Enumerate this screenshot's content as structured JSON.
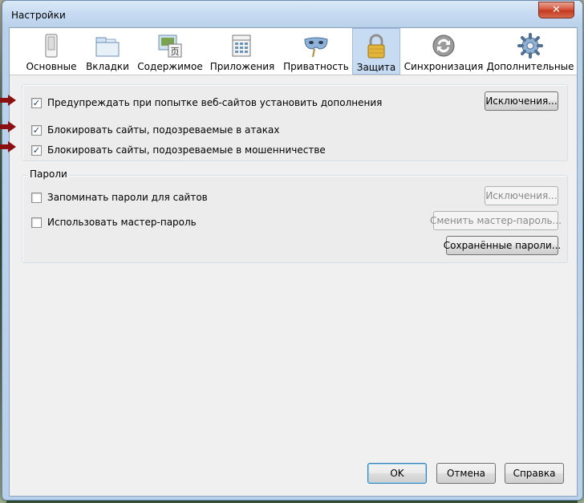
{
  "window": {
    "title": "Настройки",
    "close_glyph": "✕"
  },
  "toolbar": {
    "items": [
      {
        "label": "Основные",
        "icon": "switch-icon"
      },
      {
        "label": "Вкладки",
        "icon": "tabs-icon"
      },
      {
        "label": "Содержимое",
        "icon": "content-icon"
      },
      {
        "label": "Приложения",
        "icon": "applications-icon"
      },
      {
        "label": "Приватность",
        "icon": "mask-icon"
      },
      {
        "label": "Защита",
        "icon": "padlock-icon",
        "selected": true
      },
      {
        "label": "Синхронизация",
        "icon": "sync-icon"
      },
      {
        "label": "Дополнительные",
        "icon": "gear-icon"
      }
    ]
  },
  "security": {
    "warn_addons": {
      "label": "Предупреждать при попытке веб-сайтов установить дополнения",
      "checked": true
    },
    "block_attack": {
      "label": "Блокировать сайты, подозреваемые в атаках",
      "checked": true
    },
    "block_forgery": {
      "label": "Блокировать сайты, подозреваемые в мошенничестве",
      "checked": true
    },
    "exceptions_button": "Исключения..."
  },
  "passwords": {
    "legend": "Пароли",
    "remember": {
      "label": "Запоминать пароли для сайтов",
      "checked": false
    },
    "master": {
      "label": "Использовать мастер-пароль",
      "checked": false
    },
    "exceptions_button": "Исключения...",
    "change_master_button": "Сменить мастер-пароль...",
    "saved_button": "Сохранённые пароли..."
  },
  "footer": {
    "ok": "OK",
    "cancel": "Отмена",
    "help": "Справка"
  },
  "colors": {
    "annotation_arrow": "#8b1010",
    "selected_tab": "#c7dcf3"
  }
}
